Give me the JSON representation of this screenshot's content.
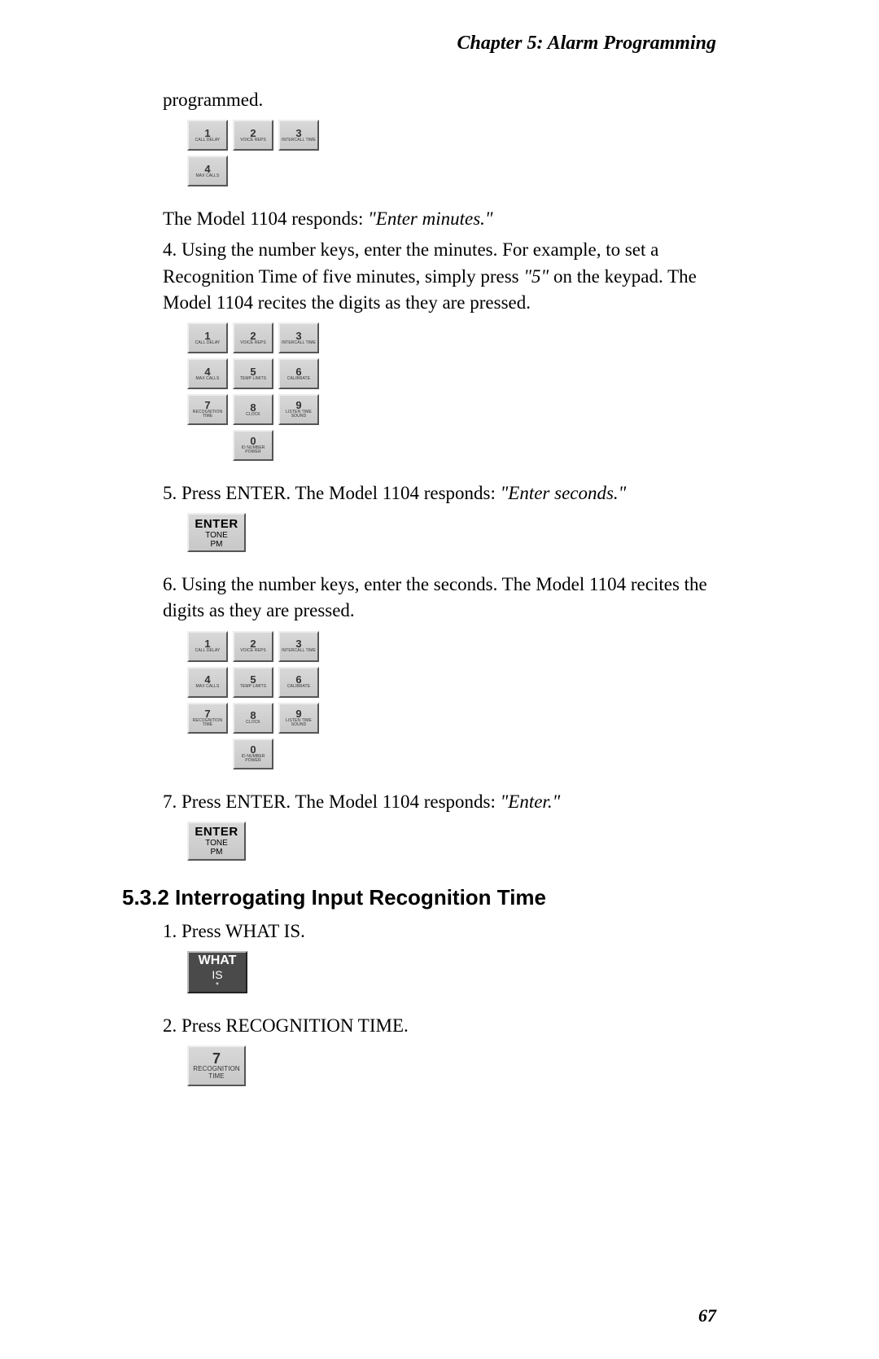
{
  "header": "Chapter 5: Alarm Programming",
  "para_programmed": "programmed.",
  "para_responds_minutes_pre": "The Model 1104 responds: ",
  "para_responds_minutes_quote": "\"Enter minutes.\"",
  "step4_a": "4.  Using the number keys, enter the minutes. For example, to set a Recognition Time of five minutes, simply press ",
  "step4_q": "\"5\"",
  "step4_b": " on the keypad. The Model 1104 recites the digits as they are pressed.",
  "step5_a": "5.  Press ENTER. The Model 1104 responds: ",
  "step5_q": "\"Enter seconds.\"",
  "step6": "6.  Using the number keys, enter the seconds. The Model 1104 recites the digits as they are pressed.",
  "step7_a": "7.  Press ENTER. The Model 1104 responds: ",
  "step7_q": "\"Enter.\"",
  "section_532": "5.3.2  Interrogating Input Recognition Time",
  "s532_step1": "1.  Press WHAT IS.",
  "s532_step2": "2.  Press RECOGNITION TIME.",
  "page_number": "67",
  "keys": {
    "k1": {
      "n": "1",
      "l": "CALL DELAY"
    },
    "k2": {
      "n": "2",
      "l": "VOICE REPS"
    },
    "k3": {
      "n": "3",
      "l": "INTERCALL TIME"
    },
    "k4": {
      "n": "4",
      "l": "MAX CALLS"
    },
    "k5": {
      "n": "5",
      "l": "TEMP LIMITS"
    },
    "k6": {
      "n": "6",
      "l": "CALIBRATE"
    },
    "k7": {
      "n": "7",
      "l": "RECOGNITION TIME"
    },
    "k8": {
      "n": "8",
      "l": "CLOCK"
    },
    "k9": {
      "n": "9",
      "l": "LISTEN TIME SOUND"
    },
    "k0": {
      "n": "0",
      "l": "ID NUMBER POWER"
    }
  },
  "enter": {
    "main": "ENTER",
    "sub1": "TONE",
    "sub2": "PM"
  },
  "whatis": {
    "l1": "WHAT",
    "l2": "IS",
    "l3": "*"
  }
}
